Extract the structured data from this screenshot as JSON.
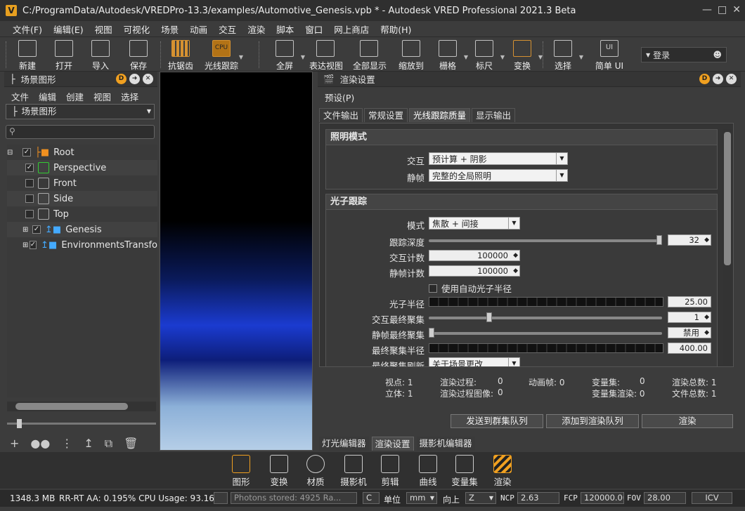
{
  "window": {
    "title": "C:/ProgramData/Autodesk/VREDPro-13.3/examples/Automotive_Genesis.vpb * - Autodesk VRED Professional 2021.3 Beta"
  },
  "menu": [
    "文件(F)",
    "编辑(E)",
    "视图",
    "可视化",
    "场景",
    "动画",
    "交互",
    "渲染",
    "脚本",
    "窗口",
    "网上商店",
    "帮助(H)"
  ],
  "toolbar": {
    "new": "新建",
    "open": "打开",
    "import": "导入",
    "save": "保存",
    "antialias": "抗锯齿",
    "raytrace": "光线跟踪",
    "fullscreen": "全屏",
    "presentation": "表达视图",
    "showall": "全部显示",
    "zoomto": "缩放到",
    "grid": "栅格",
    "ruler": "标尺",
    "transform": "变换",
    "select": "选择",
    "simple": "简单 UI",
    "login": "登录"
  },
  "scenegraph": {
    "title": "场景图形",
    "menu": [
      "文件",
      "编辑",
      "创建",
      "视图",
      "选择"
    ],
    "combo": "场景图形",
    "nodes": [
      {
        "label": "Root",
        "checked": true
      },
      {
        "label": "Perspective",
        "checked": true
      },
      {
        "label": "Front",
        "checked": false
      },
      {
        "label": "Side",
        "checked": false
      },
      {
        "label": "Top",
        "checked": false
      },
      {
        "label": "Genesis",
        "checked": true
      },
      {
        "label": "EnvironmentsTransfo",
        "checked": true
      }
    ]
  },
  "render": {
    "title": "渲染设置",
    "preset": "预设(P)",
    "tabs": [
      "文件输出",
      "常规设置",
      "光线跟踪质量",
      "显示输出"
    ],
    "lighting": {
      "title": "照明模式",
      "interactive_label": "交互",
      "interactive_value": "预计算 + 阴影",
      "still_label": "静帧",
      "still_value": "完整的全局照明"
    },
    "photon": {
      "title": "光子跟踪",
      "mode_label": "模式",
      "mode_value": "焦散 + 间接",
      "depth_label": "跟踪深度",
      "depth_value": "32",
      "icount_label": "交互计数",
      "icount_value": "100000",
      "scount_label": "静帧计数",
      "scount_value": "100000",
      "auto_label": "使用自动光子半径",
      "radius_label": "光子半径",
      "radius_value": "25.00",
      "igather_label": "交互最终聚集",
      "igather_value": "1",
      "sgather_label": "静帧最终聚集",
      "sgather_value": "禁用",
      "gradius_label": "最终聚集半径",
      "gradius_value": "400.00",
      "refresh_label": "最终聚集刷新",
      "refresh_value": "关于场景更改"
    },
    "stats": {
      "viewpoint": "视点: 1",
      "stereo": "立体: 1",
      "passes": "渲染过程:",
      "passes_v": "0",
      "passimg": "渲染过程图像:",
      "passimg_v": "0",
      "animframe": "动画帧: 0",
      "varset": "变量集:",
      "varset_v": "0",
      "varrender": "变量集渲染: 0",
      "total": "渲染总数: 1",
      "files": "文件总数: 1"
    },
    "buttons": {
      "cluster": "发送到群集队列",
      "queue": "添加到渲染队列",
      "render": "渲染"
    }
  },
  "bottomtabs": [
    "灯光编辑器",
    "渲染设置",
    "摄影机编辑器"
  ],
  "modules": [
    "图形",
    "变换",
    "材质",
    "摄影机",
    "剪辑",
    "曲线",
    "变量集",
    "渲染"
  ],
  "status": {
    "mem": "1348.3 MB",
    "info": "RR-RT AA: 0.195% CPU Usage: 93.160",
    "photons": "Photons stored: 4925 Ra...",
    "unit_label": "单位",
    "unit": "mm",
    "up_label": "向上",
    "up": "Z",
    "ncp_label": "NCP",
    "ncp": "2.63",
    "fcp_label": "FCP",
    "fcp": "120000.00",
    "fov_label": "FOV",
    "fov": "28.00",
    "icv": "ICV"
  }
}
